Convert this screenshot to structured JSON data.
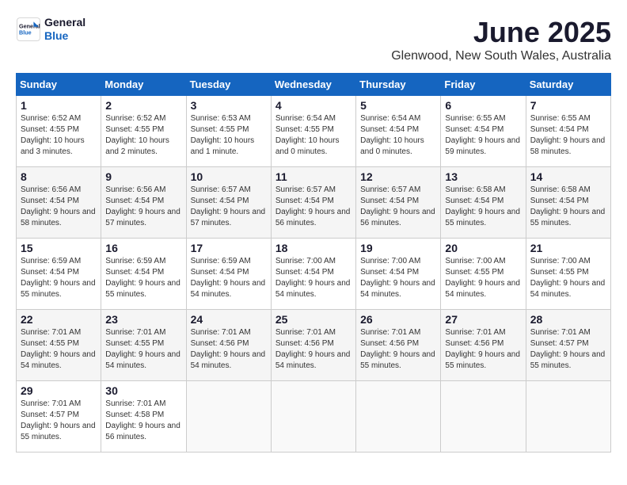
{
  "header": {
    "logo_line1": "General",
    "logo_line2": "Blue",
    "title": "June 2025",
    "subtitle": "Glenwood, New South Wales, Australia"
  },
  "weekdays": [
    "Sunday",
    "Monday",
    "Tuesday",
    "Wednesday",
    "Thursday",
    "Friday",
    "Saturday"
  ],
  "weeks": [
    [
      {
        "day": "1",
        "sunrise": "6:52 AM",
        "sunset": "4:55 PM",
        "daylight": "10 hours and 3 minutes."
      },
      {
        "day": "2",
        "sunrise": "6:52 AM",
        "sunset": "4:55 PM",
        "daylight": "10 hours and 2 minutes."
      },
      {
        "day": "3",
        "sunrise": "6:53 AM",
        "sunset": "4:55 PM",
        "daylight": "10 hours and 1 minute."
      },
      {
        "day": "4",
        "sunrise": "6:54 AM",
        "sunset": "4:55 PM",
        "daylight": "10 hours and 0 minutes."
      },
      {
        "day": "5",
        "sunrise": "6:54 AM",
        "sunset": "4:54 PM",
        "daylight": "10 hours and 0 minutes."
      },
      {
        "day": "6",
        "sunrise": "6:55 AM",
        "sunset": "4:54 PM",
        "daylight": "9 hours and 59 minutes."
      },
      {
        "day": "7",
        "sunrise": "6:55 AM",
        "sunset": "4:54 PM",
        "daylight": "9 hours and 58 minutes."
      }
    ],
    [
      {
        "day": "8",
        "sunrise": "6:56 AM",
        "sunset": "4:54 PM",
        "daylight": "9 hours and 58 minutes."
      },
      {
        "day": "9",
        "sunrise": "6:56 AM",
        "sunset": "4:54 PM",
        "daylight": "9 hours and 57 minutes."
      },
      {
        "day": "10",
        "sunrise": "6:57 AM",
        "sunset": "4:54 PM",
        "daylight": "9 hours and 57 minutes."
      },
      {
        "day": "11",
        "sunrise": "6:57 AM",
        "sunset": "4:54 PM",
        "daylight": "9 hours and 56 minutes."
      },
      {
        "day": "12",
        "sunrise": "6:57 AM",
        "sunset": "4:54 PM",
        "daylight": "9 hours and 56 minutes."
      },
      {
        "day": "13",
        "sunrise": "6:58 AM",
        "sunset": "4:54 PM",
        "daylight": "9 hours and 55 minutes."
      },
      {
        "day": "14",
        "sunrise": "6:58 AM",
        "sunset": "4:54 PM",
        "daylight": "9 hours and 55 minutes."
      }
    ],
    [
      {
        "day": "15",
        "sunrise": "6:59 AM",
        "sunset": "4:54 PM",
        "daylight": "9 hours and 55 minutes."
      },
      {
        "day": "16",
        "sunrise": "6:59 AM",
        "sunset": "4:54 PM",
        "daylight": "9 hours and 55 minutes."
      },
      {
        "day": "17",
        "sunrise": "6:59 AM",
        "sunset": "4:54 PM",
        "daylight": "9 hours and 54 minutes."
      },
      {
        "day": "18",
        "sunrise": "7:00 AM",
        "sunset": "4:54 PM",
        "daylight": "9 hours and 54 minutes."
      },
      {
        "day": "19",
        "sunrise": "7:00 AM",
        "sunset": "4:54 PM",
        "daylight": "9 hours and 54 minutes."
      },
      {
        "day": "20",
        "sunrise": "7:00 AM",
        "sunset": "4:55 PM",
        "daylight": "9 hours and 54 minutes."
      },
      {
        "day": "21",
        "sunrise": "7:00 AM",
        "sunset": "4:55 PM",
        "daylight": "9 hours and 54 minutes."
      }
    ],
    [
      {
        "day": "22",
        "sunrise": "7:01 AM",
        "sunset": "4:55 PM",
        "daylight": "9 hours and 54 minutes."
      },
      {
        "day": "23",
        "sunrise": "7:01 AM",
        "sunset": "4:55 PM",
        "daylight": "9 hours and 54 minutes."
      },
      {
        "day": "24",
        "sunrise": "7:01 AM",
        "sunset": "4:56 PM",
        "daylight": "9 hours and 54 minutes."
      },
      {
        "day": "25",
        "sunrise": "7:01 AM",
        "sunset": "4:56 PM",
        "daylight": "9 hours and 54 minutes."
      },
      {
        "day": "26",
        "sunrise": "7:01 AM",
        "sunset": "4:56 PM",
        "daylight": "9 hours and 55 minutes."
      },
      {
        "day": "27",
        "sunrise": "7:01 AM",
        "sunset": "4:56 PM",
        "daylight": "9 hours and 55 minutes."
      },
      {
        "day": "28",
        "sunrise": "7:01 AM",
        "sunset": "4:57 PM",
        "daylight": "9 hours and 55 minutes."
      }
    ],
    [
      {
        "day": "29",
        "sunrise": "7:01 AM",
        "sunset": "4:57 PM",
        "daylight": "9 hours and 55 minutes."
      },
      {
        "day": "30",
        "sunrise": "7:01 AM",
        "sunset": "4:58 PM",
        "daylight": "9 hours and 56 minutes."
      },
      null,
      null,
      null,
      null,
      null
    ]
  ]
}
